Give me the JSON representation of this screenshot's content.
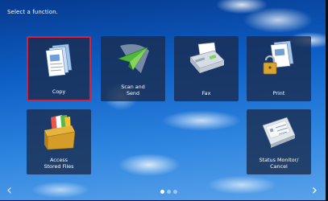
{
  "header": {
    "prompt": "Select a function."
  },
  "tiles": [
    {
      "label": "Copy",
      "icon": "copy-icon",
      "selected": true
    },
    {
      "label": "Scan and\nSend",
      "icon": "scan-send-icon"
    },
    {
      "label": "Fax",
      "icon": "fax-icon"
    },
    {
      "label": "Print",
      "icon": "print-icon"
    },
    {
      "label": "Access\nStored Files",
      "icon": "stored-files-icon"
    },
    {
      "label": "Status Monitor/\nCancel",
      "icon": "status-monitor-icon"
    }
  ],
  "nav": {
    "prev": "‹",
    "next": "›",
    "pages": 3,
    "current_page": 1
  },
  "colors": {
    "selected_border": "#d8203a",
    "tile_bg": "#1a2c4e"
  }
}
